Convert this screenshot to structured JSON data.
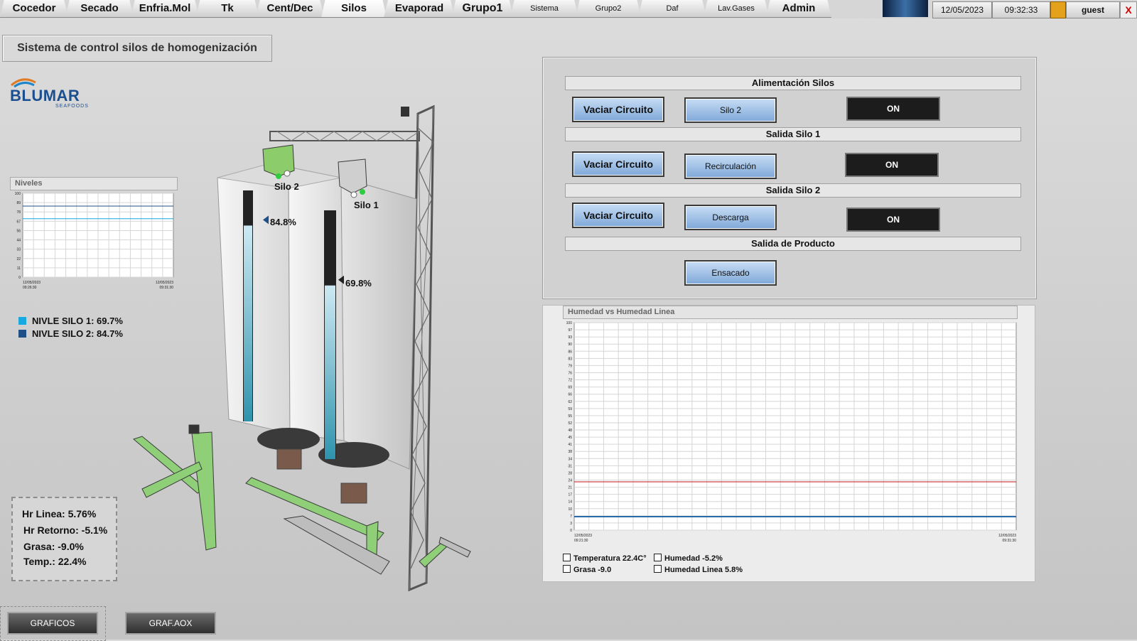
{
  "nav": {
    "tabs": [
      {
        "label": "Cocedor"
      },
      {
        "label": "Secado"
      },
      {
        "label": "Enfria.Mol"
      },
      {
        "label": "Tk"
      },
      {
        "label": "Cent/Dec"
      },
      {
        "label": "Silos"
      },
      {
        "label": "Evaporad"
      },
      {
        "label": "Grupo1"
      },
      {
        "label": "Sistema"
      },
      {
        "label": "Grupo2"
      },
      {
        "label": "Daf"
      },
      {
        "label": "Lav.Gases"
      },
      {
        "label": "Admin"
      }
    ],
    "active_tab": "Silos",
    "date": "12/05/2023",
    "time": "09:32:33",
    "user": "guest",
    "close": "X"
  },
  "page_title": "Sistema de control silos de homogenización",
  "brand": {
    "name": "BLUMAR",
    "sub": "SEAFOODS",
    "color": "#1c4f8f"
  },
  "niveles": {
    "title": "Niveles",
    "y_ticks": [
      "100",
      "89",
      "78",
      "67",
      "56",
      "44",
      "33",
      "22",
      "11",
      "0"
    ],
    "x_start_date": "12/05/2023",
    "x_start_time": "09:26:30",
    "x_end_date": "12/05/2023",
    "x_end_time": "09:31:30",
    "silo1_level": 69.7,
    "silo2_level": 84.7,
    "silo1_color": "#17a9e0",
    "silo2_color": "#1e4f86"
  },
  "legend": {
    "silo1": "NIVLE SILO 1: 69.7%",
    "silo2": "NIVLE SILO 2: 84.7%"
  },
  "silos": {
    "silo1": {
      "label": "Silo 1",
      "level_text": "69.8%",
      "level": 69.8
    },
    "silo2": {
      "label": "Silo 2",
      "level_text": "84.8%",
      "level": 84.8
    }
  },
  "readings": {
    "hr_linea": "Hr Linea:  5.76%",
    "hr_retorno": "Hr Retorno:  -5.1%",
    "grasa": "Grasa:  -9.0%",
    "temp": "Temp.: 22.4%"
  },
  "bottom_buttons": {
    "graficos": "GRAFICOS",
    "graf_aox": "GRAF.AOX"
  },
  "control": {
    "alimentacion": {
      "title": "Alimentación Silos",
      "vaciar": "Vaciar Circuito",
      "target": "Silo 2",
      "state": "ON"
    },
    "salida1": {
      "title": "Salida Silo 1",
      "vaciar": "Vaciar Circuito",
      "target": "Recirculación",
      "state": "ON"
    },
    "salida2": {
      "title": "Salida Silo 2",
      "vaciar": "Vaciar Circuito",
      "target": "Descarga",
      "state": "ON"
    },
    "producto": {
      "title": "Salida de Producto",
      "target": "Ensacado"
    }
  },
  "humedad_chart": {
    "title": "Humedad vs Humedad Linea",
    "y_ticks": [
      "100",
      "97",
      "93",
      "90",
      "86",
      "83",
      "79",
      "76",
      "72",
      "69",
      "66",
      "62",
      "59",
      "55",
      "52",
      "48",
      "45",
      "41",
      "38",
      "34",
      "31",
      "28",
      "24",
      "21",
      "17",
      "14",
      "10",
      "7",
      "3",
      "0"
    ],
    "x_start_date": "12/05/2023",
    "x_start_time": "09:21:30",
    "x_end_date": "12/05/2023",
    "x_end_time": "09:31:30",
    "red_level": 23.3,
    "blue_level": 6.5,
    "red_color": "#d04040",
    "blue_color": "#2a6aa8",
    "checks": {
      "temperatura": "Temperatura 22.4C°",
      "humedad": "Humedad -5.2%",
      "grasa": "Grasa  -9.0",
      "humedad_linea": "Humedad Linea  5.8%"
    }
  }
}
